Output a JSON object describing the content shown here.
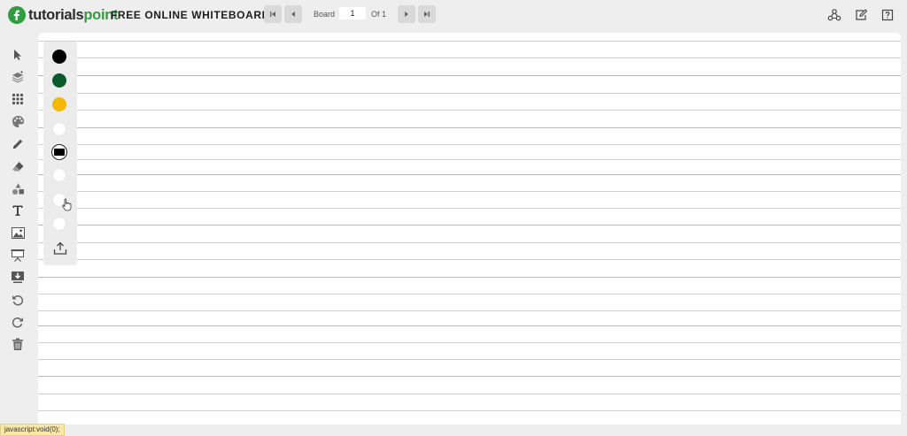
{
  "header": {
    "logo_text_primary": "tutorials",
    "logo_text_accent": "point",
    "title": "FREE ONLINE WHITEBOARD",
    "board_label": "Board",
    "board_value": "1",
    "board_of": "Of 1"
  },
  "palette": {
    "colors": [
      "#000000",
      "#0b5a2a",
      "#f5b800",
      "#ffffff"
    ],
    "selected_size": "rectangle"
  },
  "status": {
    "text": "javascript:void(0);"
  },
  "colors": {
    "brand_green": "#2e9e3e",
    "background": "#eeeeee",
    "board": "#ffffff",
    "toolbar_icon": "#555555"
  },
  "icons": {
    "toolbar": [
      "pointer-icon",
      "layers-icon",
      "grid-icon",
      "palette-icon",
      "pencil-icon",
      "eraser-icon",
      "shapes-icon",
      "text-icon",
      "image-icon",
      "presentation-icon",
      "download-icon",
      "undo-icon",
      "redo-icon",
      "trash-icon"
    ],
    "header_right": [
      "share-icon",
      "edit-icon",
      "help-icon"
    ]
  }
}
